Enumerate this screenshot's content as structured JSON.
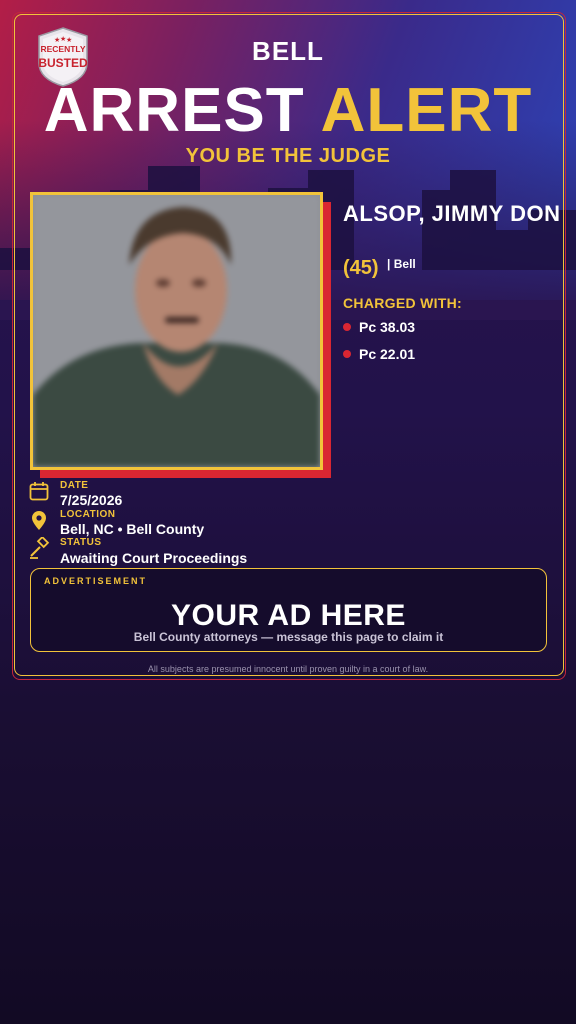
{
  "header": {
    "logo_text_line1": "RECENTLY",
    "logo_text_line2": "BUSTED",
    "county": "BELL",
    "headline_word1": "ARREST",
    "headline_word2": "ALERT",
    "tagline": "YOU BE THE JUDGE"
  },
  "subject": {
    "name": "ALSOP, JIMMY DON",
    "age": "(45)",
    "location_short": "| Bell",
    "photo_icon": "mugshot-photo"
  },
  "charges": {
    "heading": "CHARGED WITH:",
    "items": [
      "Pc 38.03",
      "Pc 22.01"
    ]
  },
  "details": {
    "date_label": "DATE",
    "date_value": "7/25/2026",
    "date_icon": "calendar-icon",
    "location_label": "LOCATION",
    "location_value": "Bell, NC • Bell County",
    "location_icon": "map-pin-icon",
    "status_label": "STATUS",
    "status_value": "Awaiting Court Proceedings",
    "status_icon": "gavel-icon"
  },
  "ad": {
    "label": "ADVERTISEMENT",
    "title": "YOUR AD HERE",
    "subtitle": "Bell County attorneys — message this page to claim it"
  },
  "footer": {
    "disclaimer": "All subjects are presumed innocent until proven guilty in a court of law."
  },
  "colors": {
    "accent_gold": "#f2c33a",
    "accent_red": "#d92632",
    "background": "#22124a"
  }
}
